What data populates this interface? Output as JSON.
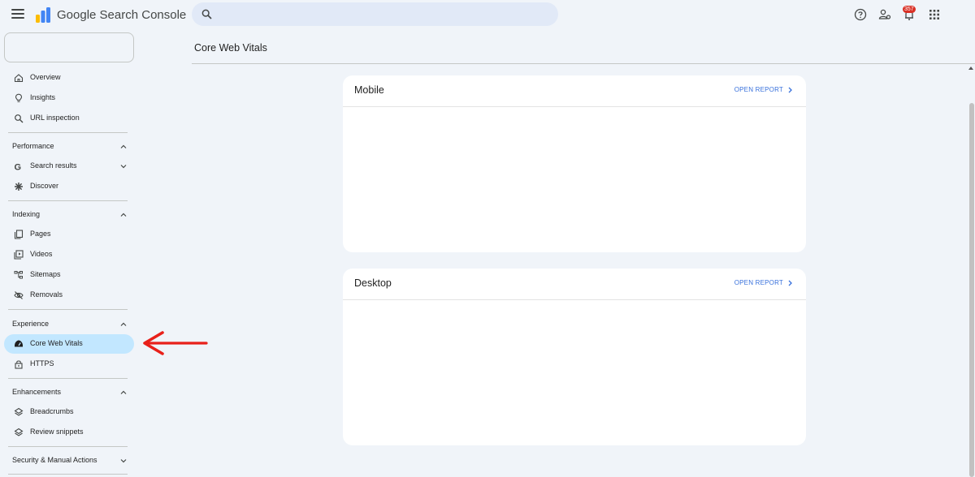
{
  "header": {
    "app_title": "Google Search Console",
    "search_placeholder": "",
    "notification_count": "357",
    "icons": [
      "menu-icon",
      "search-icon",
      "help-icon",
      "manage-users-icon",
      "notifications-icon",
      "apps-grid-icon"
    ]
  },
  "sidebar": {
    "property_selector": "",
    "top_items": [
      {
        "label": "Overview",
        "icon": "home-icon"
      },
      {
        "label": "Insights",
        "icon": "lightbulb-icon"
      },
      {
        "label": "URL inspection",
        "icon": "search-icon"
      }
    ],
    "performance": {
      "title": "Performance",
      "items": [
        {
          "label": "Search results",
          "icon": "google-g-icon"
        },
        {
          "label": "Discover",
          "icon": "asterisk-icon"
        }
      ]
    },
    "indexing": {
      "title": "Indexing",
      "items": [
        {
          "label": "Pages",
          "icon": "pages-icon"
        },
        {
          "label": "Videos",
          "icon": "video-icon"
        },
        {
          "label": "Sitemaps",
          "icon": "sitemap-icon"
        },
        {
          "label": "Removals",
          "icon": "eye-off-icon"
        }
      ]
    },
    "experience": {
      "title": "Experience",
      "items": [
        {
          "label": "Core Web Vitals",
          "icon": "speedometer-icon",
          "active": true
        },
        {
          "label": "HTTPS",
          "icon": "lock-icon"
        }
      ]
    },
    "enhancements": {
      "title": "Enhancements",
      "items": [
        {
          "label": "Breadcrumbs",
          "icon": "layers-icon"
        },
        {
          "label": "Review snippets",
          "icon": "layers-icon"
        }
      ]
    },
    "security": {
      "title": "Security & Manual Actions"
    }
  },
  "main": {
    "page_title": "Core Web Vitals",
    "cards": [
      {
        "title": "Mobile",
        "link": "OPEN REPORT"
      },
      {
        "title": "Desktop",
        "link": "OPEN REPORT"
      }
    ]
  },
  "colors": {
    "background": "#f0f4f9",
    "active_nav": "#c2e7ff",
    "link": "#3871dc",
    "badge": "#d93025",
    "annotation_arrow": "#e8201a"
  }
}
